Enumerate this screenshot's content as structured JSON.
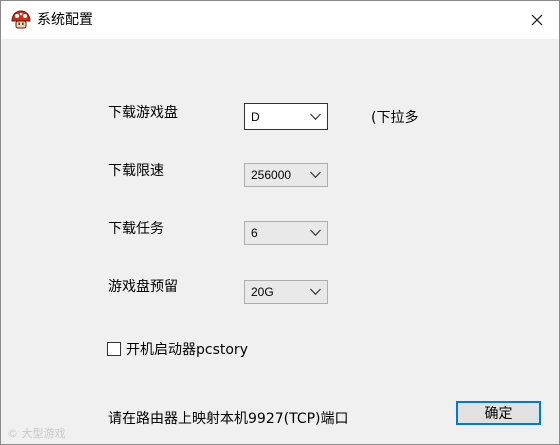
{
  "window": {
    "title": "系统配置",
    "close_glyph": "✕"
  },
  "form": {
    "game_disk": {
      "label": "下载游戏盘",
      "value": "D",
      "hint": "(下拉多"
    },
    "speed_limit": {
      "label": "下载限速",
      "value": "256000"
    },
    "tasks": {
      "label": "下载任务",
      "value": "6"
    },
    "reserve": {
      "label": "游戏盘预留",
      "value": "20G"
    },
    "autostart": {
      "label": "开机启动器pcstory",
      "checked": false
    }
  },
  "footer": {
    "note": "请在路由器上映射本机9927(TCP)端口",
    "ok_label": "确定"
  },
  "watermark": "© 大型游戏",
  "icons": {
    "app": "mushroom-app-icon",
    "close": "close-icon",
    "dropdown": "chevron-down-icon"
  }
}
